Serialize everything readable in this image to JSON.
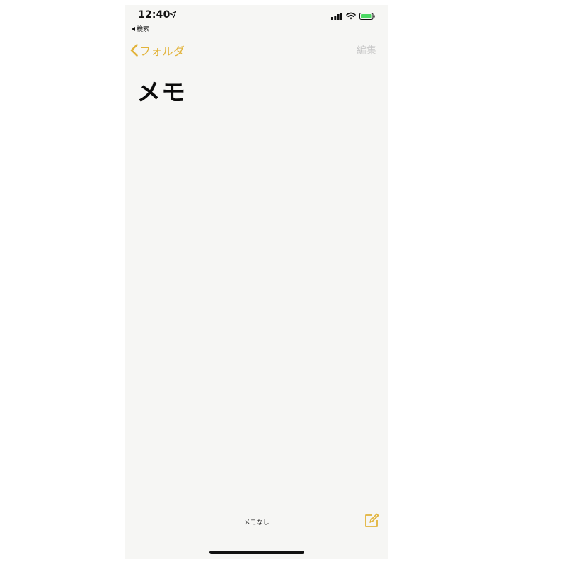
{
  "status_bar": {
    "time": "12:40",
    "back_to_app": "検索"
  },
  "nav": {
    "back_label": "フォルダ",
    "edit_label": "編集"
  },
  "page": {
    "title": "メモ"
  },
  "toolbar": {
    "note_count": "メモなし"
  },
  "colors": {
    "accent": "#e2b33a",
    "background": "#f6f6f4",
    "disabled": "#c7c7c7",
    "battery": "#4cd964"
  },
  "icons": {
    "location": "location-arrow-icon",
    "signal": "cellular-signal-icon",
    "wifi": "wifi-icon",
    "battery": "battery-icon",
    "back": "chevron-left-icon",
    "compose": "compose-icon"
  }
}
